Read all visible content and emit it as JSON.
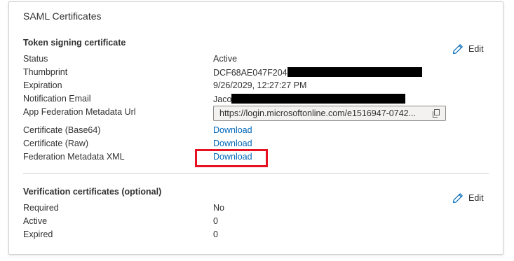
{
  "card_title": "SAML Certificates",
  "token_section": {
    "title": "Token signing certificate",
    "edit_label": "Edit",
    "rows": {
      "status": {
        "label": "Status",
        "value": "Active"
      },
      "thumbprint": {
        "label": "Thumbprint",
        "value": "DCF68AE047F204"
      },
      "expiration": {
        "label": "Expiration",
        "value": "9/26/2029, 12:27:27 PM"
      },
      "notification_email": {
        "label": "Notification Email",
        "value": "Jaco"
      },
      "metadata_url": {
        "label": "App Federation Metadata Url",
        "value": "https://login.microsoftonline.com/e1516947-0742..."
      },
      "cert_base64": {
        "label": "Certificate (Base64)",
        "value": "Download"
      },
      "cert_raw": {
        "label": "Certificate (Raw)",
        "value": "Download"
      },
      "federation_xml": {
        "label": "Federation Metadata XML",
        "value": "Download"
      }
    }
  },
  "verification_section": {
    "title": "Verification certificates (optional)",
    "edit_label": "Edit",
    "rows": {
      "required": {
        "label": "Required",
        "value": "No"
      },
      "active": {
        "label": "Active",
        "value": "0"
      },
      "expired": {
        "label": "Expired",
        "value": "0"
      }
    }
  },
  "colors": {
    "link": "#0067b8",
    "highlight": "#e81123",
    "edit_icon": "#0067b8"
  },
  "icons": {
    "edit": "pencil-icon",
    "copy": "copy-icon"
  }
}
